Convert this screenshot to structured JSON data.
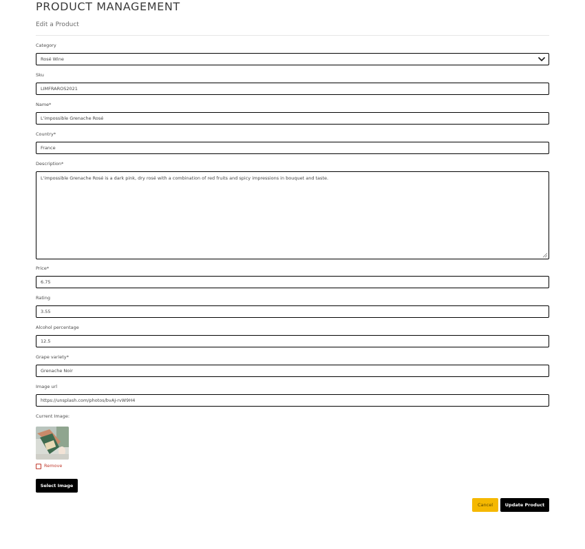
{
  "header": {
    "title": "PRODUCT MANAGEMENT",
    "subtitle": "Edit a Product"
  },
  "form": {
    "category": {
      "label": "Category",
      "value": "Rosé Wine"
    },
    "sku": {
      "label": "Sku",
      "value": "LIMFRAROS2021"
    },
    "name": {
      "label": "Name*",
      "value": "L'impossible Grenache Rosé"
    },
    "country": {
      "label": "Country*",
      "value": "France"
    },
    "description": {
      "label": "Description*",
      "value": "L'impossible Grenache Rosé is a dark pink, dry rosé with a combination of red fruits and spicy impressions in bouquet and taste."
    },
    "price": {
      "label": "Price*",
      "value": "6.75"
    },
    "rating": {
      "label": "Rating",
      "value": "3.55"
    },
    "alcohol": {
      "label": "Alcohol percentage",
      "value": "12.5"
    },
    "grape": {
      "label": "Grape variety*",
      "value": "Grenache Noir"
    },
    "image_url": {
      "label": "Image url",
      "value": "https://unsplash.com/photos/bvAJ-rvW9H4"
    },
    "current_image": {
      "label": "Current Image:"
    },
    "remove": {
      "label": "Remove",
      "checked": false
    }
  },
  "buttons": {
    "select_image": "Select Image",
    "cancel": "Cancel",
    "update": "Update Product"
  },
  "colors": {
    "cancel_bg": "#f5b800",
    "primary_bg": "#000000",
    "remove_red": "#c0392b"
  }
}
